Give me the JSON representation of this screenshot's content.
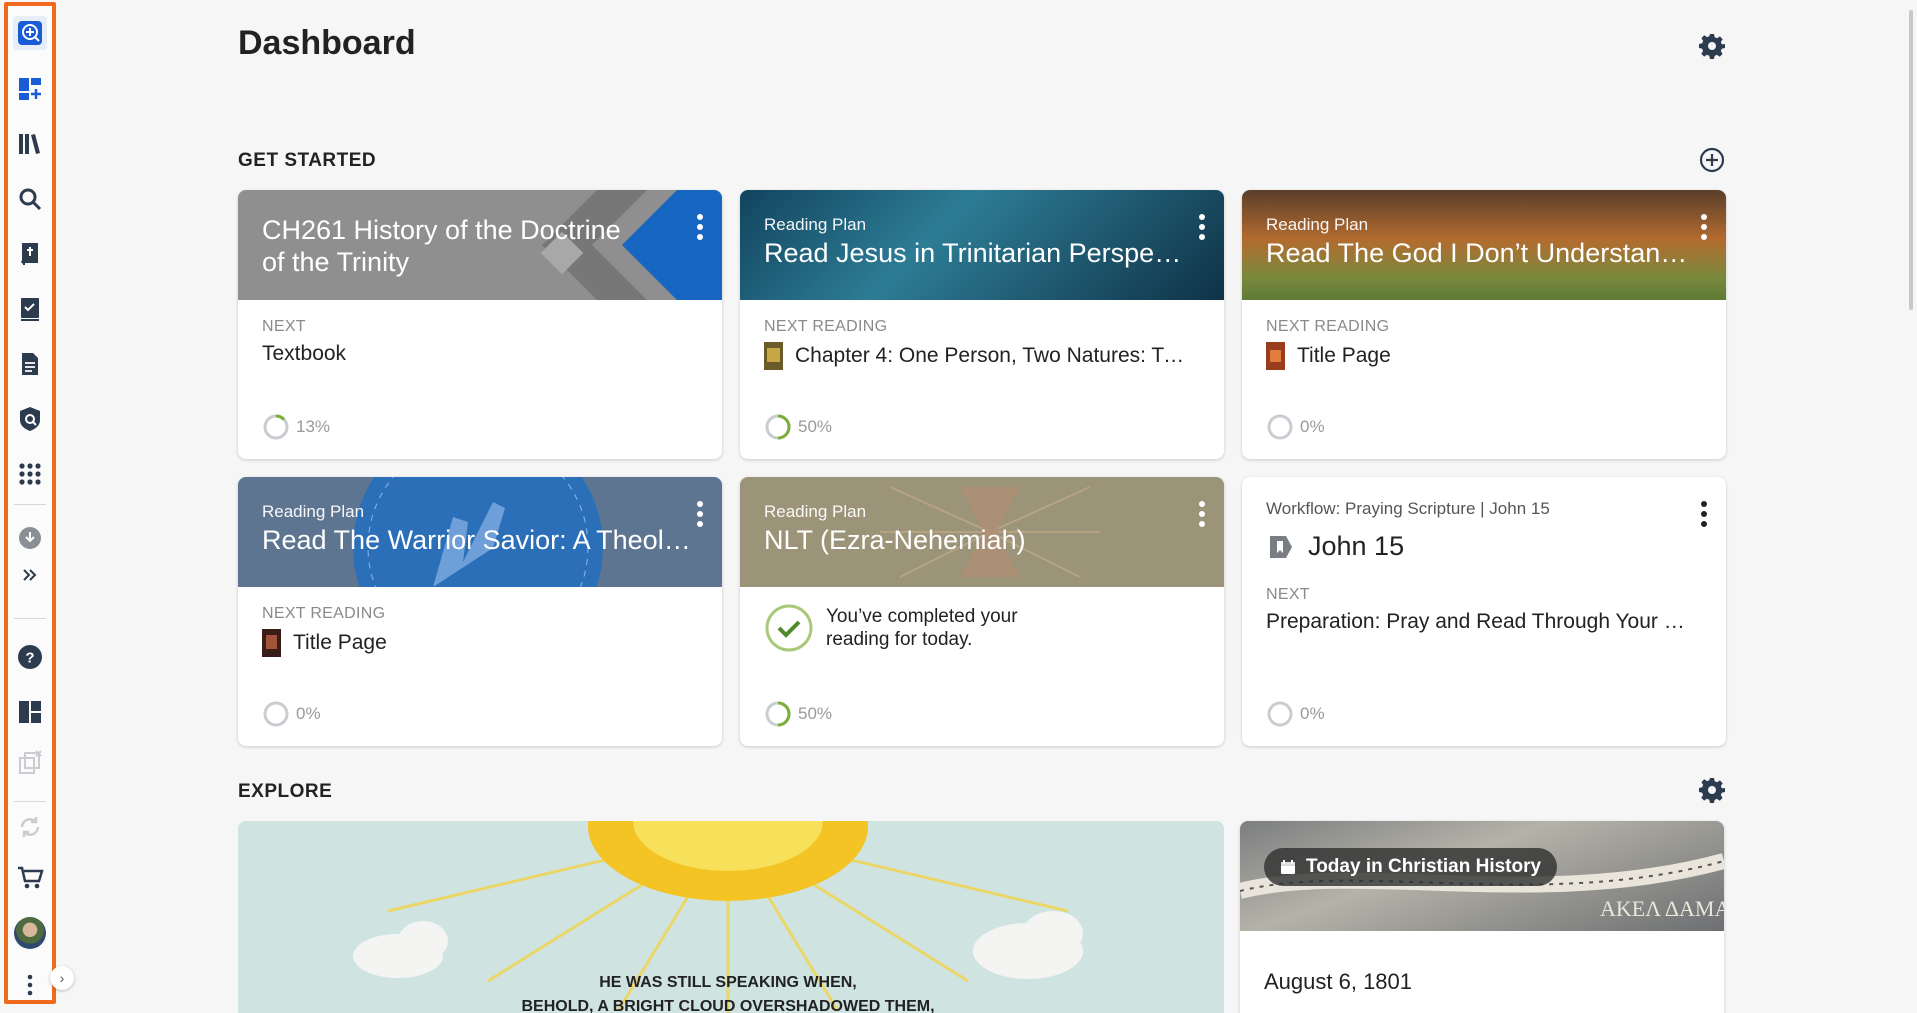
{
  "page": {
    "title": "Dashboard"
  },
  "sections": {
    "get_started": "GET STARTED",
    "explore": "EXPLORE"
  },
  "cards": [
    {
      "kind": "",
      "name": "CH261 History of the Doctrine of the Trinity",
      "label": "NEXT",
      "next": "Textbook",
      "progress": "13%"
    },
    {
      "kind": "Reading Plan",
      "name": "Read Jesus in Trinitarian Perspecti…",
      "label": "NEXT READING",
      "next": "Chapter 4: One Person, Two Natures: Tw…",
      "progress": "50%"
    },
    {
      "kind": "Reading Plan",
      "name": "Read The God I Don’t Understand:…",
      "label": "NEXT READING",
      "next": "Title Page",
      "progress": "0%"
    },
    {
      "kind": "Reading Plan",
      "name": "Read The Warrior Savior: A Theolo…",
      "label": "NEXT READING",
      "next": "Title Page",
      "progress": "0%"
    },
    {
      "kind": "Reading Plan",
      "name": "NLT (Ezra-Nehemiah)",
      "completed": "You’ve completed your reading for today.",
      "progress": "50%"
    },
    {
      "kind": "Workflow: Praying Scripture | John 15",
      "name": "John 15",
      "label": "NEXT",
      "next": "Preparation: Pray and Read Through Your Pas…",
      "progress": "0%"
    }
  ],
  "explore": {
    "verse_line1": "HE WAS STILL SPEAKING WHEN,",
    "verse_line2": "BEHOLD, A BRIGHT CLOUD OVERSHADOWED THEM,",
    "history_badge": "Today in Christian History",
    "history_date": "August 6, 1801",
    "map_text": "AKEΛ ΔAMA"
  },
  "progress_values": [
    0.13,
    0.5,
    0,
    0,
    0.5,
    0
  ],
  "colors": {
    "accent": "#f06a1d",
    "brand": "#1a5bd6",
    "progress": "#7cad3a"
  }
}
